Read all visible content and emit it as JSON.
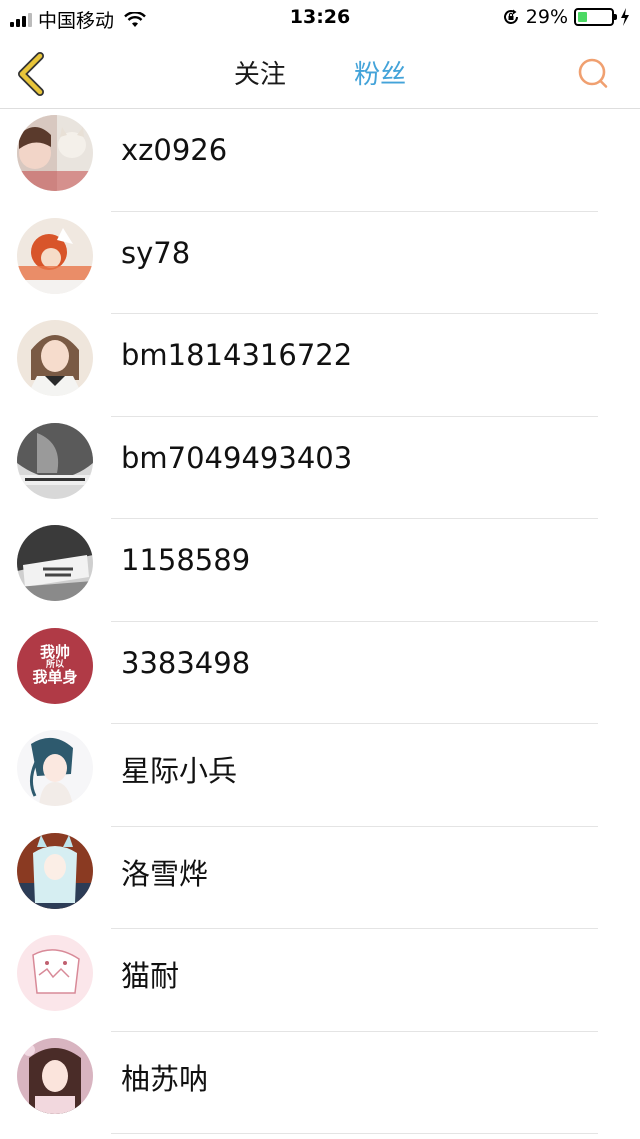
{
  "status_bar": {
    "carrier": "中国移动",
    "time": "13:26",
    "battery_percent": "29%",
    "battery_level": 0.29,
    "icons": [
      "signal-icon",
      "wifi-icon",
      "rotation-lock-icon",
      "battery-icon",
      "charging-icon"
    ]
  },
  "nav": {
    "back_icon": "chevron-left-icon",
    "tabs": [
      {
        "label": "关注",
        "active": false
      },
      {
        "label": "粉丝",
        "active": true
      }
    ],
    "search_icon": "search-icon",
    "colors": {
      "active_tab": "#43a3d9",
      "back_icon": "#e8c53a",
      "search_icon": "#f0a070"
    }
  },
  "fans": [
    {
      "name": "xz0926"
    },
    {
      "name": "sy78"
    },
    {
      "name": "bm1814316722"
    },
    {
      "name": "bm7049493403"
    },
    {
      "name": "1158589"
    },
    {
      "name": "3383498",
      "avatar_text": [
        "我帅",
        "所以",
        "我单身"
      ]
    },
    {
      "name": "星际小兵"
    },
    {
      "name": "洛雪烨"
    },
    {
      "name": "猫耐"
    },
    {
      "name": "柚苏呐"
    }
  ]
}
